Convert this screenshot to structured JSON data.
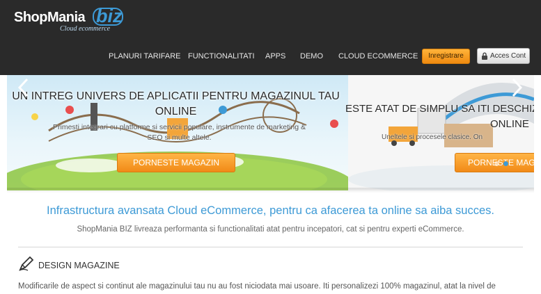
{
  "brand": {
    "name": "ShopMania",
    "suffix": "biz",
    "tagline": "Cloud ecommerce"
  },
  "nav": {
    "items": [
      {
        "label": "PLANURI TARIFARE"
      },
      {
        "label": "FUNCTIONALITATI"
      },
      {
        "label": "APPS"
      },
      {
        "label": "DEMO"
      },
      {
        "label": "CLOUD ECOMMERCE"
      }
    ],
    "register_label": "Inregistrare",
    "login_label": "Acces Cont"
  },
  "slider": {
    "slides": [
      {
        "title_line1": "UN INTREG UNIVERS DE APLICATII PENTRU MAGAZINUL TAU",
        "title_line2": "ONLINE",
        "subtitle_line1": "Primesti integrari cu platforme si servicii populare, instrumente de marketing &",
        "subtitle_line2": "SEO si multe altele.",
        "button_label": "PORNESTE MAGAZIN"
      },
      {
        "title_line1": "ESTE ATAT DE SIMPLU SA ITI DESCHIZI",
        "title_line2": "ONLINE",
        "subtitle": "Uneltele si procesele clasice. On",
        "button_label": "PORNESTE MAGAZIN"
      }
    ],
    "active_dot": 1
  },
  "content": {
    "headline": "Infrastructura avansata Cloud eCommerce, pentru ca afacerea ta online sa aiba succes.",
    "subline": "ShopMania BIZ livreaza performanta si functionalitati atat pentru incepatori, cat si pentru experti eCommerce.",
    "section": {
      "title": "DESIGN MAGAZINE",
      "body": "Modificarile de aspect si continut ale magazinului tau nu au fost niciodata mai usoare. Iti personalizezi 100% magazinul, atat la nivel de"
    }
  },
  "colors": {
    "header_bg": "#2a2a2a",
    "accent_blue": "#3d9ad6",
    "accent_orange": "#f18a17"
  }
}
